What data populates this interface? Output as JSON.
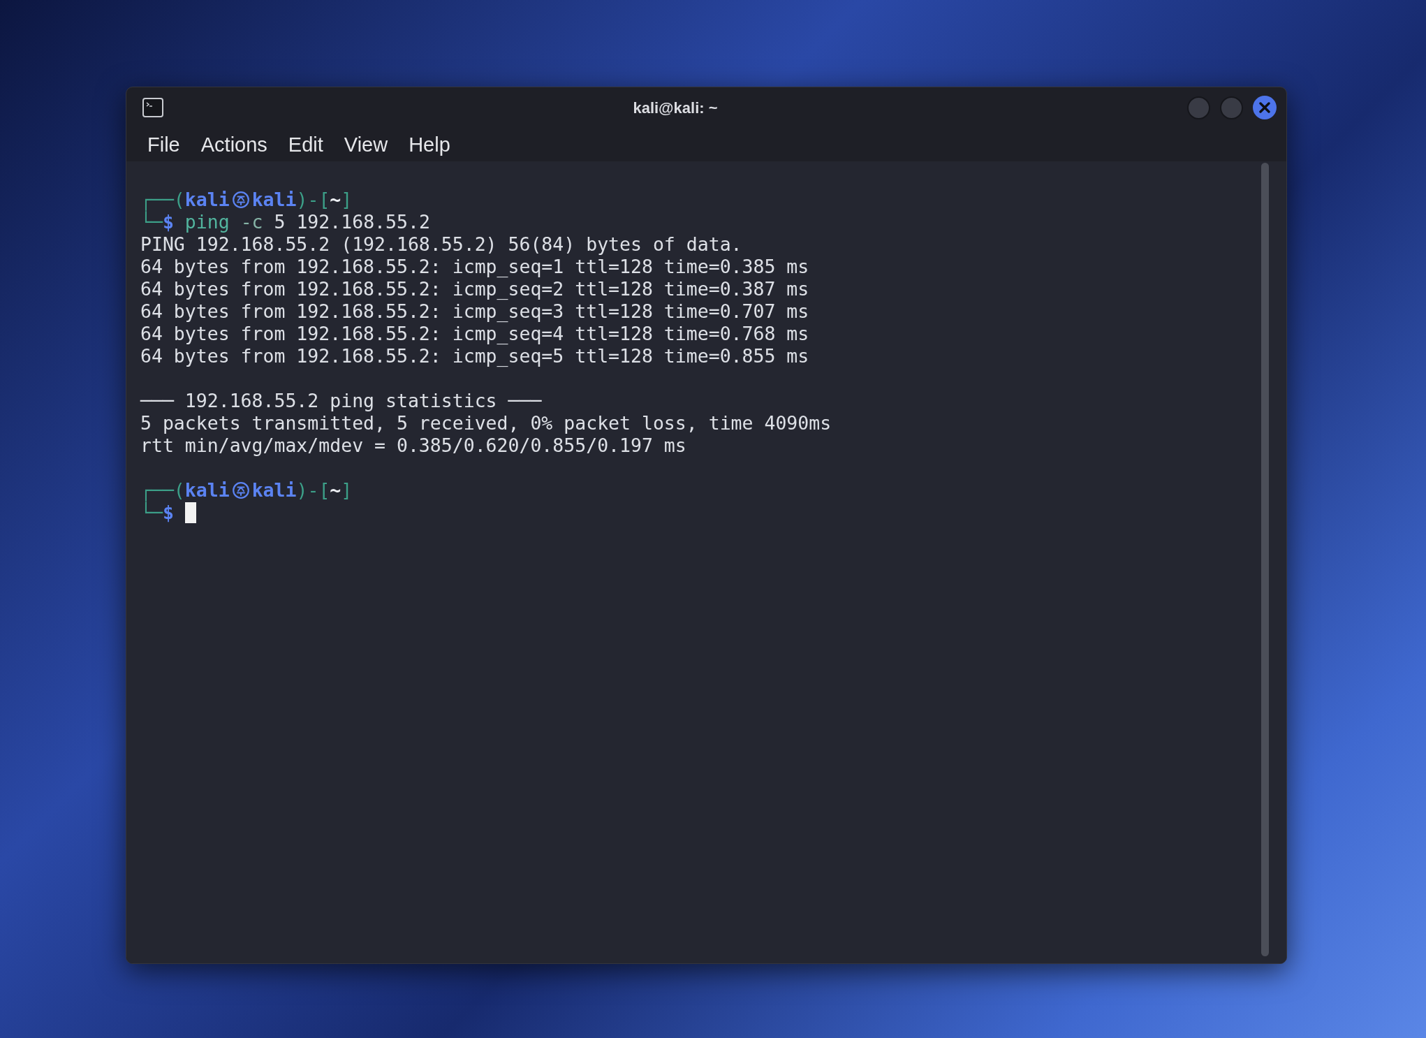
{
  "window": {
    "title": "kali@kali: ~"
  },
  "menu": [
    "File",
    "Actions",
    "Edit",
    "View",
    "Help"
  ],
  "terminal": {
    "lines": [
      {
        "kind": "prompt",
        "segments": [
          {
            "kind": "frame",
            "text": "┌──("
          },
          {
            "kind": "user",
            "text": "kali"
          },
          {
            "kind": "symbol"
          },
          {
            "kind": "user",
            "text": "kali"
          },
          {
            "kind": "frame",
            "text": ")-["
          },
          {
            "kind": "path",
            "text": "~"
          },
          {
            "kind": "frame",
            "text": "]"
          }
        ]
      },
      {
        "kind": "command",
        "segments": [
          {
            "kind": "frame",
            "text": "└─"
          },
          {
            "kind": "sign",
            "text": "$"
          },
          {
            "kind": "program",
            "text": " ping"
          },
          {
            "kind": "option",
            "text": " -c"
          },
          {
            "kind": "plain",
            "text": " 5 192.168.55.2"
          }
        ]
      },
      {
        "kind": "output",
        "text": "PING 192.168.55.2 (192.168.55.2) 56(84) bytes of data."
      },
      {
        "kind": "output",
        "text": "64 bytes from 192.168.55.2: icmp_seq=1 ttl=128 time=0.385 ms"
      },
      {
        "kind": "output",
        "text": "64 bytes from 192.168.55.2: icmp_seq=2 ttl=128 time=0.387 ms"
      },
      {
        "kind": "output",
        "text": "64 bytes from 192.168.55.2: icmp_seq=3 ttl=128 time=0.707 ms"
      },
      {
        "kind": "output",
        "text": "64 bytes from 192.168.55.2: icmp_seq=4 ttl=128 time=0.768 ms"
      },
      {
        "kind": "output",
        "text": "64 bytes from 192.168.55.2: icmp_seq=5 ttl=128 time=0.855 ms"
      },
      {
        "kind": "blank"
      },
      {
        "kind": "output",
        "text": "─── 192.168.55.2 ping statistics ───"
      },
      {
        "kind": "output",
        "text": "5 packets transmitted, 5 received, 0% packet loss, time 4090ms"
      },
      {
        "kind": "output",
        "text": "rtt min/avg/max/mdev = 0.385/0.620/0.855/0.197 ms"
      },
      {
        "kind": "blank"
      },
      {
        "kind": "prompt",
        "segments": [
          {
            "kind": "frame",
            "text": "┌──("
          },
          {
            "kind": "user",
            "text": "kali"
          },
          {
            "kind": "symbol"
          },
          {
            "kind": "user",
            "text": "kali"
          },
          {
            "kind": "frame",
            "text": ")-["
          },
          {
            "kind": "path",
            "text": "~"
          },
          {
            "kind": "frame",
            "text": "]"
          }
        ]
      },
      {
        "kind": "input",
        "segments": [
          {
            "kind": "frame",
            "text": "└─"
          },
          {
            "kind": "sign",
            "text": "$"
          }
        ],
        "cursor": true
      }
    ]
  }
}
